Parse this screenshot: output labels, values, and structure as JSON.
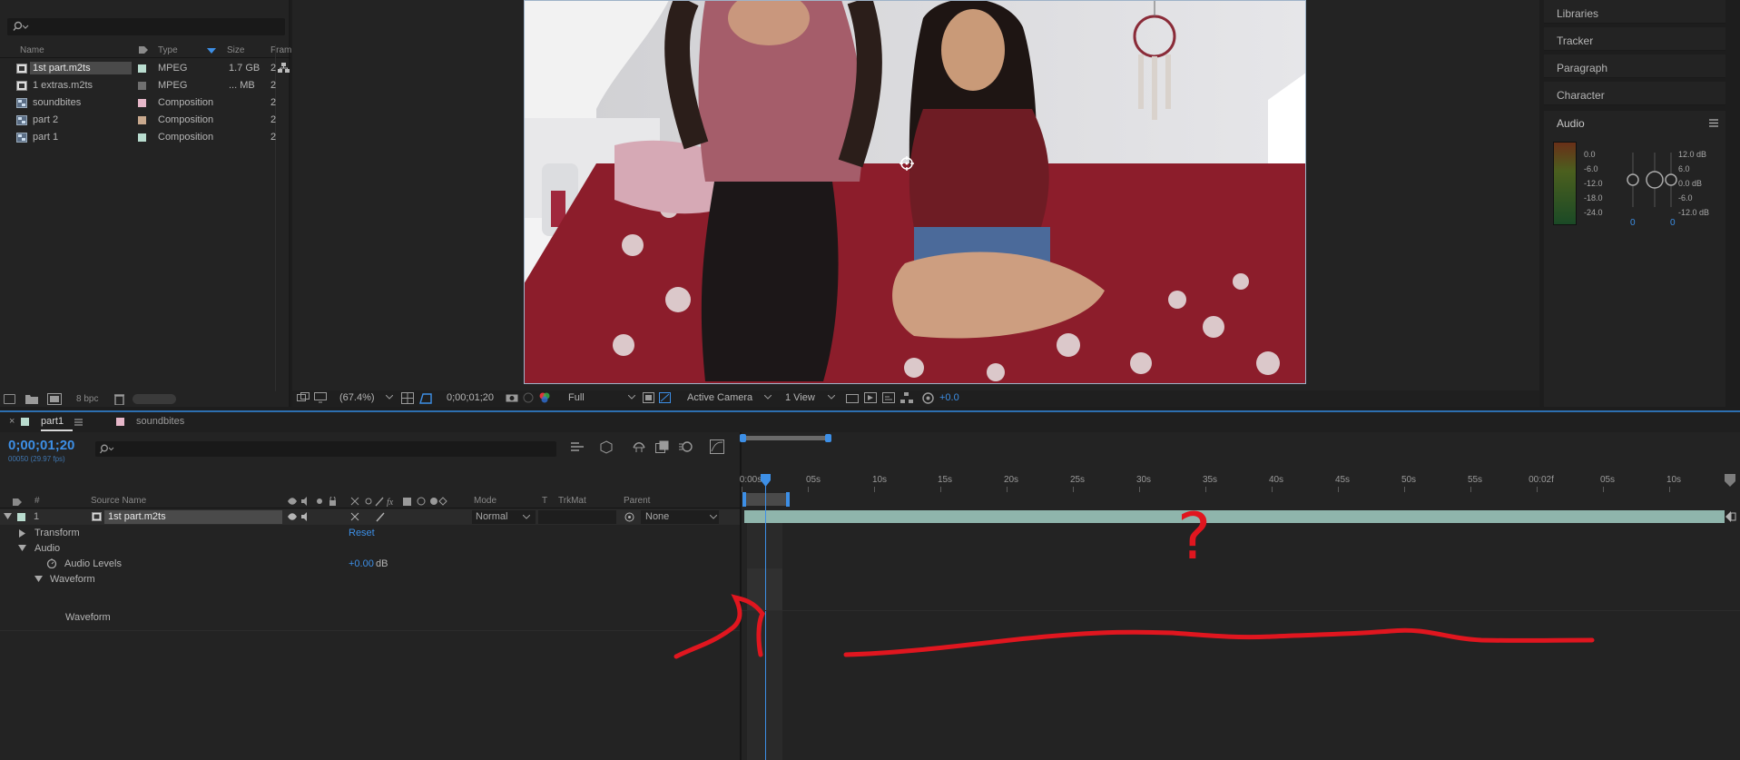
{
  "project": {
    "search_placeholder": "",
    "columns": {
      "name": "Name",
      "type": "Type",
      "size": "Size",
      "frame": "Fram"
    },
    "items": [
      {
        "name": "1st part.m2ts",
        "type": "MPEG",
        "size": "1.7 GB",
        "frame": "2",
        "label_color": "#b9dccf",
        "kind": "footage",
        "selected": true
      },
      {
        "name": "1 extras.m2ts",
        "type": "MPEG",
        "size": "... MB",
        "frame": "2",
        "label_color": "#6f6f6f",
        "kind": "footage",
        "selected": false
      },
      {
        "name": "soundbites",
        "type": "Composition",
        "size": "",
        "frame": "2",
        "label_color": "#e6b7c9",
        "kind": "comp",
        "selected": false
      },
      {
        "name": "part 2",
        "type": "Composition",
        "size": "",
        "frame": "2",
        "label_color": "#c9a98e",
        "kind": "comp",
        "selected": false
      },
      {
        "name": "part 1",
        "type": "Composition",
        "size": "",
        "frame": "2",
        "label_color": "#b9dccf",
        "kind": "comp",
        "selected": false
      }
    ],
    "bit_depth": "8 bpc"
  },
  "viewer_bar": {
    "zoom": "(67.4%)",
    "timecode": "0;00;01;20",
    "resolution": "Full",
    "camera": "Active Camera",
    "views": "1 View",
    "exposure": "+0.0"
  },
  "right_panels": {
    "libraries": "Libraries",
    "tracker": "Tracker",
    "paragraph": "Paragraph",
    "character": "Character",
    "audio": "Audio",
    "meter_scale": [
      "0.0",
      "-6.0",
      "-12.0",
      "-18.0",
      "-24.0"
    ],
    "level_scale": [
      "12.0 dB",
      "6.0",
      "0.0 dB",
      "-6.0",
      "-12.0 dB"
    ],
    "left_value": "0",
    "right_value": "0"
  },
  "timeline": {
    "tabs": [
      {
        "label": "part1",
        "label_color": "#b9dccf",
        "active": true
      },
      {
        "label": "soundbites",
        "label_color": "#e6b7c9",
        "active": false
      }
    ],
    "current_time": "0;00;01;20",
    "fps_line": "00050 (29.97 fps)",
    "columns": {
      "num": "#",
      "source": "Source Name",
      "mode": "Mode",
      "t": "T",
      "trkmat": "TrkMat",
      "parent": "Parent"
    },
    "layer": {
      "index": "1",
      "name": "1st part.m2ts",
      "mode": "Normal",
      "parent": "None",
      "label_color": "#b9dccf"
    },
    "properties": {
      "transform": "Transform",
      "transform_value": "Reset",
      "audio": "Audio",
      "audio_levels": "Audio Levels",
      "audio_levels_value": "+0.00",
      "audio_levels_unit": "dB",
      "waveform_group": "Waveform",
      "waveform": "Waveform"
    },
    "ruler": [
      "0:00s",
      "05s",
      "10s",
      "15s",
      "20s",
      "25s",
      "30s",
      "35s",
      "40s",
      "45s",
      "50s",
      "55s",
      "00:02f",
      "05s",
      "10s"
    ]
  },
  "annotation": {
    "question_mark": "?"
  },
  "colors": {
    "accent": "#2d8ceb",
    "annotation": "#e0161f",
    "layer_bar": "#8fb5ac"
  }
}
